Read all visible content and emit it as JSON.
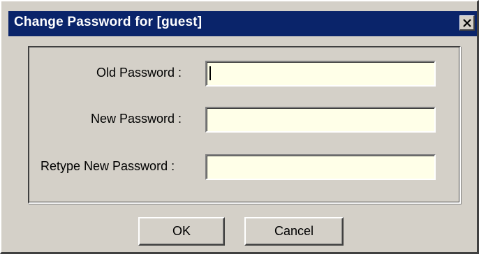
{
  "window": {
    "title": "Change Password for [guest]",
    "close_icon": "close-icon"
  },
  "form": {
    "old_password": {
      "label": "Old Password :",
      "value": ""
    },
    "new_password": {
      "label": "New Password :",
      "value": ""
    },
    "retype_password": {
      "label": "Retype New Password :",
      "value": ""
    }
  },
  "buttons": {
    "ok": "OK",
    "cancel": "Cancel"
  },
  "colors": {
    "titlebar": "#0a246a",
    "dialog_face": "#d4d0c8",
    "field_background": "#ffffe8"
  }
}
